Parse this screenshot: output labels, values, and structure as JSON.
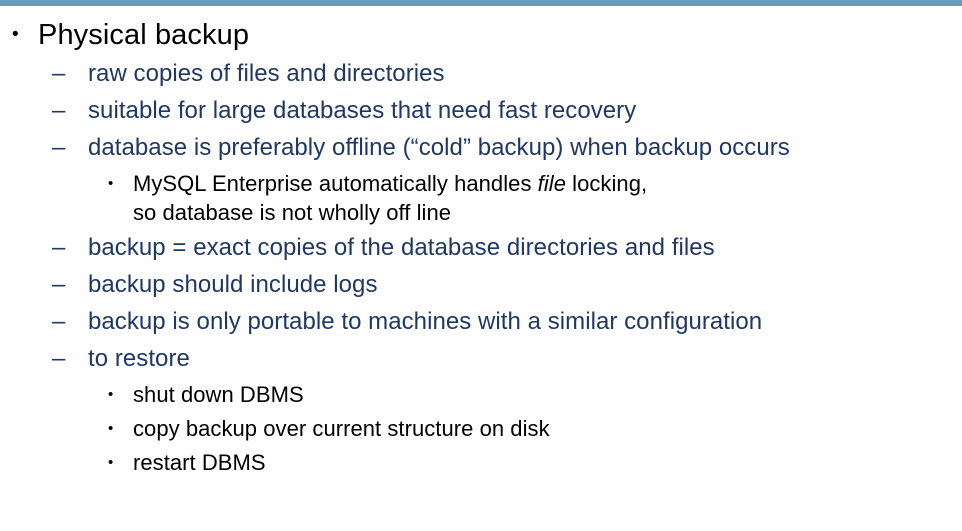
{
  "slide": {
    "accent_color": "#6f9ab5",
    "level1_color": "#000000",
    "level2_color": "#1F3864",
    "level3_color": "#000000",
    "title": "Physical backup",
    "title_marker": "•",
    "dash_marker": "–",
    "dot_marker": "•",
    "lines": [
      {
        "level": 2,
        "marker": "–",
        "text": "raw copies of files and directories"
      },
      {
        "level": 2,
        "marker": "–",
        "text": "suitable for large databases that need fast recovery"
      },
      {
        "level": 2,
        "marker": "–",
        "text": "database is preferably offline (“cold” backup) when backup occurs"
      },
      {
        "level": 3,
        "marker": "•",
        "text_before_italic": "MySQL Enterprise automatically handles ",
        "italic": "file",
        "text_after_italic": " locking,\nso database is not wholly off line"
      },
      {
        "level": 2,
        "marker": "–",
        "text": "backup = exact copies of the database directories and files"
      },
      {
        "level": 2,
        "marker": "–",
        "text": "backup should include logs"
      },
      {
        "level": 2,
        "marker": "–",
        "text": "backup is only portable to machines with a similar configuration"
      },
      {
        "level": 2,
        "marker": "–",
        "text": "to restore"
      },
      {
        "level": 3,
        "marker": "•",
        "text": "shut down DBMS"
      },
      {
        "level": 3,
        "marker": "•",
        "text": "copy backup over current structure on disk"
      },
      {
        "level": 3,
        "marker": "•",
        "text": "restart DBMS"
      }
    ]
  }
}
